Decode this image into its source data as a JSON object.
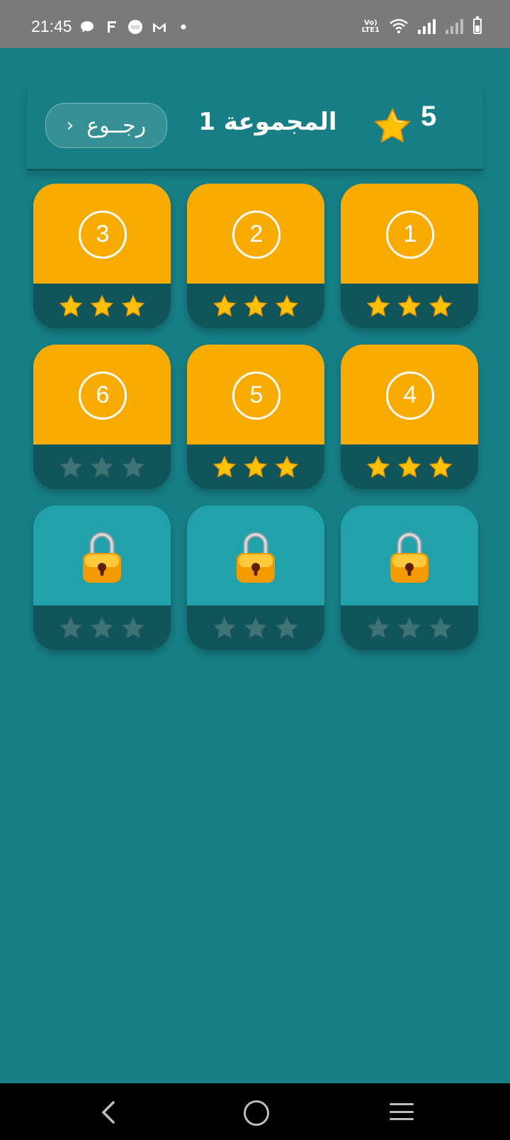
{
  "status_bar": {
    "time": "21:45",
    "left_icons": [
      "chat-icon",
      "music-icon",
      "app-icon",
      "gmail-icon",
      "dot-icon"
    ],
    "volte": "Vo)\nLTE1"
  },
  "header": {
    "back_label": "رجــوع",
    "back_chevron": "›",
    "title": "المجموعة 1",
    "score": "5"
  },
  "levels": [
    {
      "number": "1",
      "locked": false,
      "stars_earned": 3
    },
    {
      "number": "2",
      "locked": false,
      "stars_earned": 3
    },
    {
      "number": "3",
      "locked": false,
      "stars_earned": 3
    },
    {
      "number": "4",
      "locked": false,
      "stars_earned": 3
    },
    {
      "number": "5",
      "locked": false,
      "stars_earned": 3
    },
    {
      "number": "6",
      "locked": false,
      "stars_earned": 0
    },
    {
      "number": "",
      "locked": true,
      "stars_earned": 0
    },
    {
      "number": "",
      "locked": true,
      "stars_earned": 0
    },
    {
      "number": "",
      "locked": true,
      "stars_earned": 0
    }
  ],
  "colors": {
    "background": "#167f85",
    "tile_unlocked": "#f8ac02",
    "tile_locked": "#22a1ab",
    "tile_footer": "#0f5559",
    "star_gold": "#ffc107",
    "star_empty": "#3e7378"
  }
}
